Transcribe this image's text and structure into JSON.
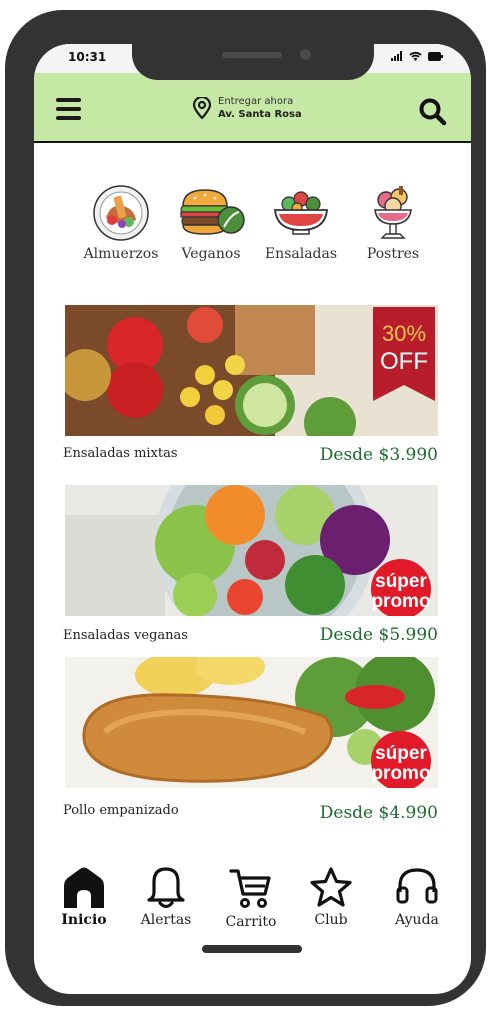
{
  "status": {
    "time": "10:31"
  },
  "header": {
    "deliver_label": "Entregar ahora",
    "address": "Av. Santa Rosa",
    "icons": [
      "menu-icon",
      "location-pin-icon",
      "search-icon"
    ],
    "accent": "#c5e8a5"
  },
  "categories": [
    {
      "label": "Almuerzos",
      "icon": "lunch-plate-icon"
    },
    {
      "label": "Veganos",
      "icon": "vegan-burger-icon"
    },
    {
      "label": "Ensaladas",
      "icon": "salad-bowl-icon"
    },
    {
      "label": "Postres",
      "icon": "dessert-cup-icon"
    }
  ],
  "offers": [
    {
      "name": "Ensaladas mixtas",
      "price": "Desde $3.990",
      "badge_top": "30%",
      "badge_bottom": "OFF"
    },
    {
      "name": "Ensaladas veganas",
      "price": "Desde $5.990",
      "badge_top": "súper",
      "badge_bottom": "promo"
    },
    {
      "name": "Pollo empanizado",
      "price": "Desde $4.990",
      "badge_top": "súper",
      "badge_bottom": "promo"
    }
  ],
  "price_color": "#1e6b30",
  "bottom_nav": [
    {
      "label": "Inicio",
      "icon": "home-icon",
      "active": true
    },
    {
      "label": "Alertas",
      "icon": "bell-icon"
    },
    {
      "label": "Carrito",
      "icon": "cart-icon"
    },
    {
      "label": "Club",
      "icon": "star-icon"
    },
    {
      "label": "Ayuda",
      "icon": "headset-icon"
    }
  ]
}
